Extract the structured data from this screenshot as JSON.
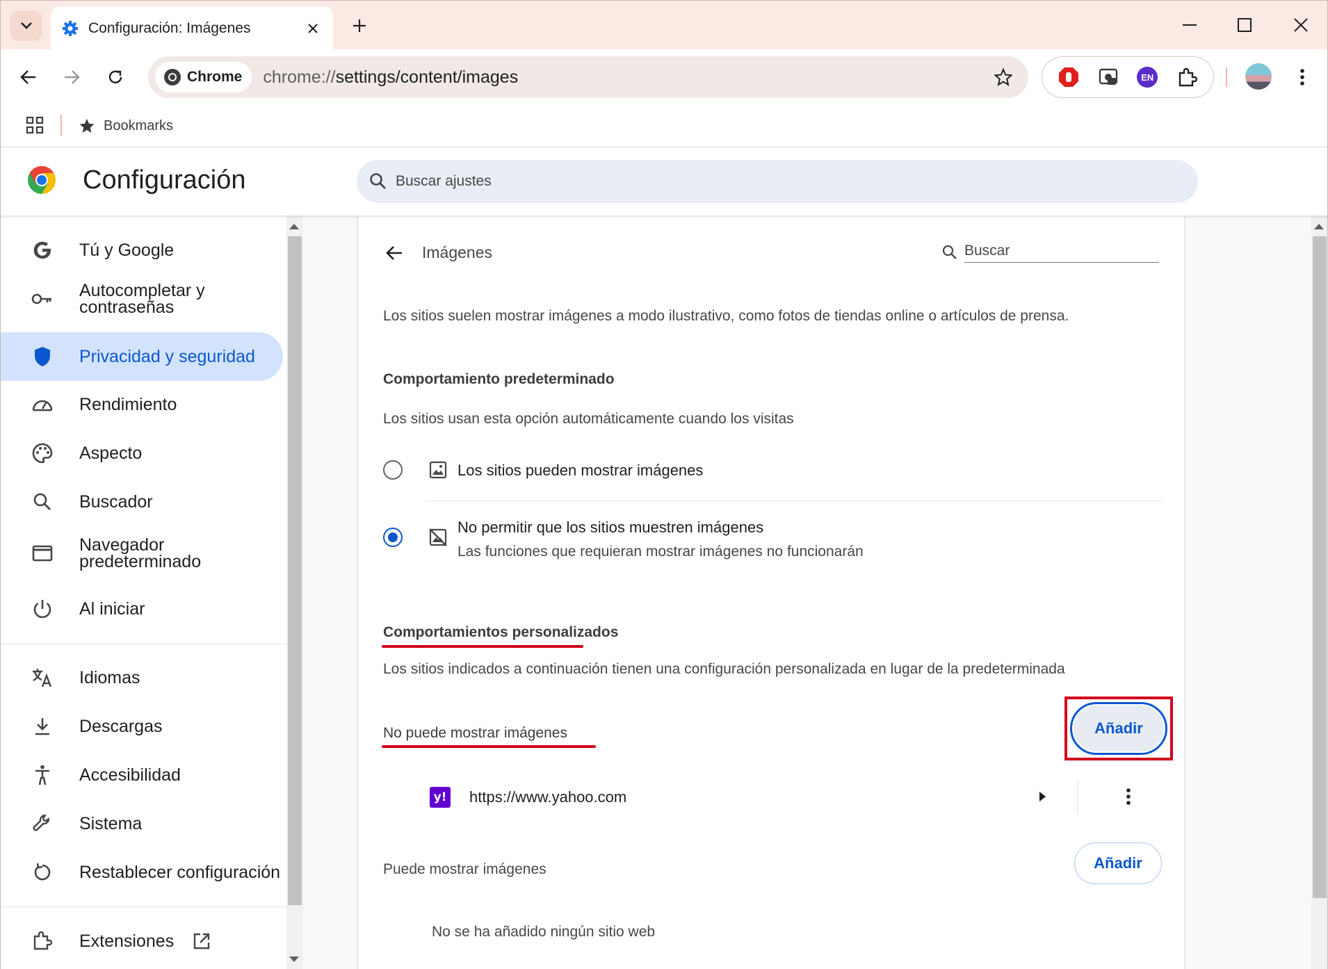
{
  "browser": {
    "tab_title": "Configuración: Imágenes",
    "chip_label": "Chrome",
    "url_scheme": "chrome://",
    "url_path": "settings/content/images",
    "bookmarks_label": "Bookmarks",
    "ext_badge": "EN"
  },
  "header": {
    "title": "Configuración",
    "search_placeholder": "Buscar ajustes"
  },
  "sidebar": {
    "items": [
      {
        "label": "Tú y Google"
      },
      {
        "label": "Autocompletar y contraseñas"
      },
      {
        "label": "Privacidad y seguridad"
      },
      {
        "label": "Rendimiento"
      },
      {
        "label": "Aspecto"
      },
      {
        "label": "Buscador"
      },
      {
        "label": "Navegador predeterminado"
      },
      {
        "label": "Al iniciar"
      },
      {
        "label": "Idiomas"
      },
      {
        "label": "Descargas"
      },
      {
        "label": "Accesibilidad"
      },
      {
        "label": "Sistema"
      },
      {
        "label": "Restablecer configuración"
      },
      {
        "label": "Extensiones"
      }
    ]
  },
  "page": {
    "heading": "Imágenes",
    "search_placeholder": "Buscar",
    "intro": "Los sitios suelen mostrar imágenes a modo ilustrativo, como fotos de tiendas online o artículos de prensa.",
    "default_title": "Comportamiento predeterminado",
    "default_desc": "Los sitios usan esta opción automáticamente cuando los visitas",
    "option_allow": "Los sitios pueden mostrar imágenes",
    "option_block": "No permitir que los sitios muestren imágenes",
    "option_block_sub": "Las funciones que requieran mostrar imágenes no funcionarán",
    "custom_title": "Comportamientos personalizados",
    "custom_desc": "Los sitios indicados a continuación tienen una configuración personalizada en lugar de la predeterminada",
    "blocked_title": "No puede mostrar imágenes",
    "add_label": "Añadir",
    "blocked_site": "https://www.yahoo.com",
    "favicon_text": "y!",
    "allowed_title": "Puede mostrar imágenes",
    "allowed_empty": "No se ha añadido ningún sitio web"
  }
}
